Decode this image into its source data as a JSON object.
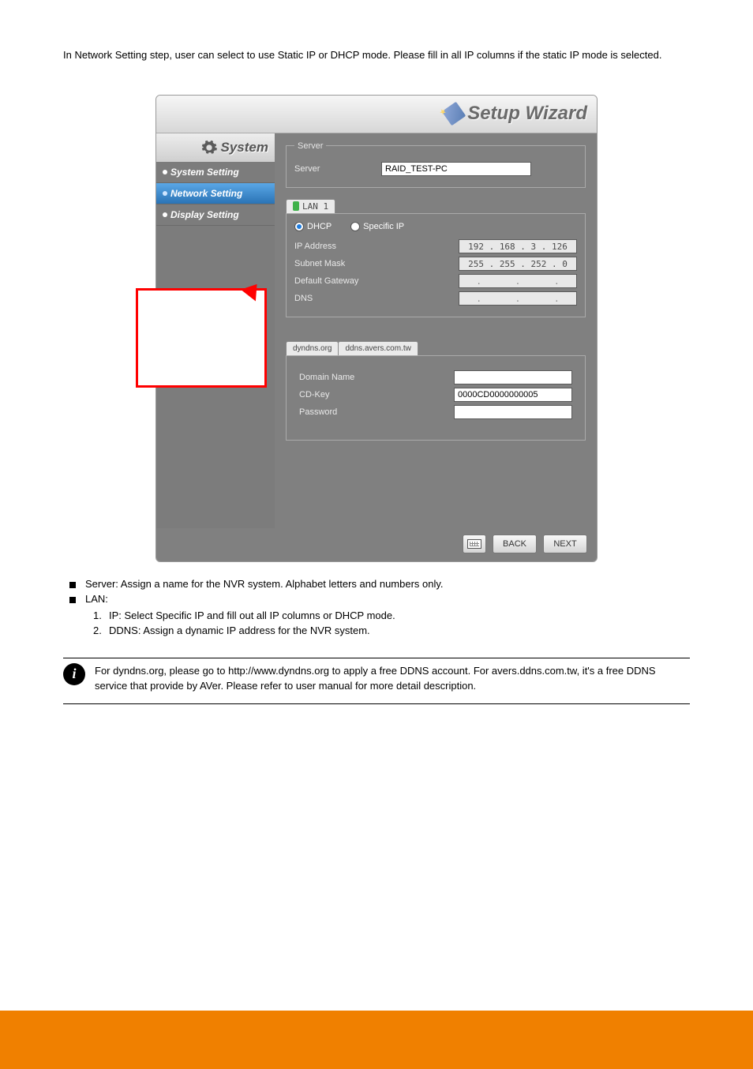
{
  "intro": "In Network Setting step, user can select to use Static IP or DHCP mode. Please fill in all IP columns if the static IP mode is selected.",
  "wizard_title": "Setup Wizard",
  "sidebar": {
    "header": "System",
    "items": [
      {
        "label": "System Setting"
      },
      {
        "label": "Network Setting"
      },
      {
        "label": "Display Setting"
      }
    ]
  },
  "server_fieldset": {
    "legend": "Server",
    "label": "Server",
    "value": "RAID_TEST-PC"
  },
  "lan": {
    "tab": "LAN 1",
    "dhcp": "DHCP",
    "specific": "Specific IP",
    "ip_label": "IP Address",
    "ip_value": "192 . 168 .  3  . 126",
    "subnet_label": "Subnet Mask",
    "subnet_value": "255 . 255 . 252 .  0",
    "gateway_label": "Default Gateway",
    "dns_label": "DNS"
  },
  "ddns": {
    "tab1": "dyndns.org",
    "tab2": "ddns.avers.com.tw",
    "domain_label": "Domain Name",
    "cdkey_label": "CD-Key",
    "cdkey_value": "0000CD0000000005",
    "password_label": "Password"
  },
  "buttons": {
    "back": "BACK",
    "next": "NEXT"
  },
  "bullets": {
    "server": "Server: Assign a name for the NVR system. Alphabet letters and numbers only.",
    "lan_lead": "LAN:",
    "lan_1": "IP: Select Specific IP and fill out all IP columns or DHCP mode.",
    "lan_2": "DDNS: Assign a dynamic IP address for the NVR system."
  },
  "note": "For dyndns.org, please go to http://www.dyndns.org to apply a free DDNS account. For avers.ddns.com.tw, it's a free DDNS service that provide by AVer. Please refer to user manual for more detail description."
}
